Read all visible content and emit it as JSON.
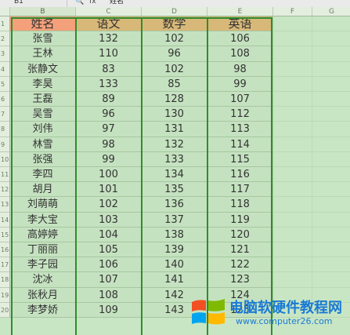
{
  "formula_bar": {
    "name_box": "B1",
    "zoom_icon": "zoom-icon",
    "fx_label": "fx",
    "content": "姓名"
  },
  "columns": [
    "B",
    "C",
    "D",
    "E",
    "F",
    "G"
  ],
  "rows": [
    "1",
    "2",
    "3",
    "4",
    "5",
    "6",
    "7",
    "8",
    "9",
    "10",
    "11",
    "12",
    "13",
    "14",
    "15",
    "16",
    "17",
    "18",
    "19",
    "20"
  ],
  "table": {
    "headers": [
      "姓名",
      "语文",
      "数学",
      "英语"
    ],
    "records": [
      [
        "张雪",
        "132",
        "102",
        "106"
      ],
      [
        "王林",
        "110",
        "96",
        "108"
      ],
      [
        "张静文",
        "83",
        "102",
        "98"
      ],
      [
        "李昊",
        "133",
        "85",
        "99"
      ],
      [
        "王磊",
        "89",
        "128",
        "107"
      ],
      [
        "吴雪",
        "96",
        "130",
        "112"
      ],
      [
        "刘伟",
        "97",
        "131",
        "113"
      ],
      [
        "林雪",
        "98",
        "132",
        "114"
      ],
      [
        "张强",
        "99",
        "133",
        "115"
      ],
      [
        "李四",
        "100",
        "134",
        "116"
      ],
      [
        "胡月",
        "101",
        "135",
        "117"
      ],
      [
        "刘萌萌",
        "102",
        "136",
        "118"
      ],
      [
        "李大宝",
        "103",
        "137",
        "119"
      ],
      [
        "高婷婷",
        "104",
        "138",
        "120"
      ],
      [
        "丁丽丽",
        "105",
        "139",
        "121"
      ],
      [
        "李子园",
        "106",
        "140",
        "122"
      ],
      [
        "沈冰",
        "107",
        "141",
        "123"
      ],
      [
        "张秋月",
        "108",
        "142",
        "124"
      ],
      [
        "李梦娇",
        "109",
        "143",
        "125"
      ]
    ]
  },
  "colors": {
    "name_header": "#f4a07a",
    "subject_header": "#d8b878",
    "data_fill": "#c5e2c0",
    "table_border": "#2f8d2f"
  },
  "watermark": {
    "title": "电脑软硬件教程网",
    "url": "www.computer26.com"
  }
}
